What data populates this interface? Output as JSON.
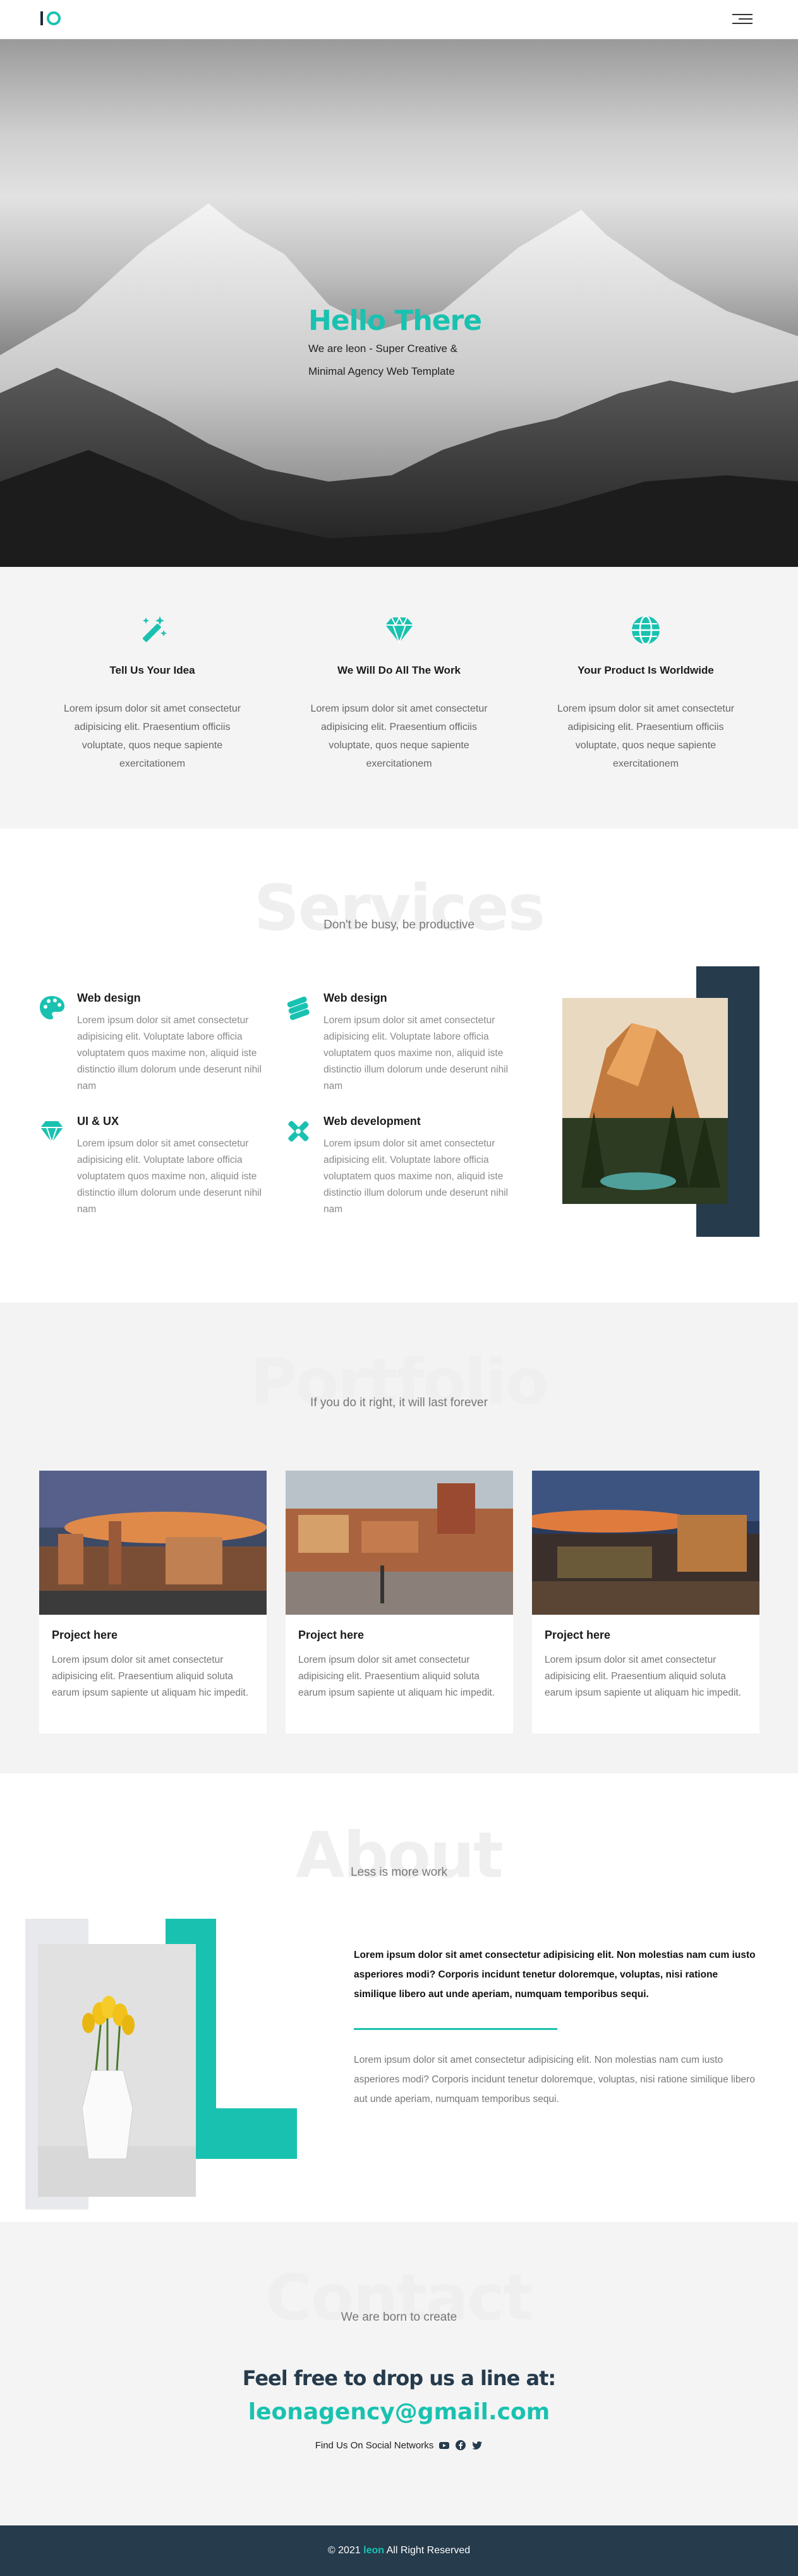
{
  "header": {
    "logo_alt": "leon",
    "menu_icon": "hamburger-menu-icon"
  },
  "hero": {
    "title": "Hello There",
    "subtitle_line1": "We are leon - Super Creative &",
    "subtitle_line2": "Minimal Agency Web Template"
  },
  "features": [
    {
      "icon": "magic-wand-icon",
      "title": "Tell Us Your Idea",
      "text": "Lorem ipsum dolor sit amet consectetur adipisicing elit. Praesentium officiis voluptate, quos neque sapiente exercitationem"
    },
    {
      "icon": "diamond-icon",
      "title": "We Will Do All The Work",
      "text": "Lorem ipsum dolor sit amet consectetur adipisicing elit. Praesentium officiis voluptate, quos neque sapiente exercitationem"
    },
    {
      "icon": "globe-icon",
      "title": "Your Product Is Worldwide",
      "text": "Lorem ipsum dolor sit amet consectetur adipisicing elit. Praesentium officiis voluptate, quos neque sapiente exercitationem"
    }
  ],
  "services": {
    "title": "Services",
    "subtitle": "Don't be busy, be productive",
    "items": [
      {
        "icon": "palette-icon",
        "title": "Web design",
        "text": "Lorem ipsum dolor sit amet consectetur adipisicing elit. Voluptate labore officia voluptatem quos maxime non, aliquid iste distinctio illum dolorum unde deserunt nihil nam"
      },
      {
        "icon": "stack-icon",
        "title": "Web design",
        "text": "Lorem ipsum dolor sit amet consectetur adipisicing elit. Voluptate labore officia voluptatem quos maxime non, aliquid iste distinctio illum dolorum unde deserunt nihil nam"
      },
      {
        "icon": "diamond-icon",
        "title": "UI & UX",
        "text": "Lorem ipsum dolor sit amet consectetur adipisicing elit. Voluptate labore officia voluptatem quos maxime non, aliquid iste distinctio illum dolorum unde deserunt nihil nam"
      },
      {
        "icon": "tools-icon",
        "title": "Web development",
        "text": "Lorem ipsum dolor sit amet consectetur adipisicing elit. Voluptate labore officia voluptatem quos maxime non, aliquid iste distinctio illum dolorum unde deserunt nihil nam"
      }
    ]
  },
  "portfolio": {
    "title": "Portfolio",
    "subtitle": "If you do it right, it will last forever",
    "cards": [
      {
        "title": "Project here",
        "text": "Lorem ipsum dolor sit amet consectetur adipisicing elit. Praesentium aliquid soluta earum ipsum sapiente ut aliquam hic impedit."
      },
      {
        "title": "Project here",
        "text": "Lorem ipsum dolor sit amet consectetur adipisicing elit. Praesentium aliquid soluta earum ipsum sapiente ut aliquam hic impedit."
      },
      {
        "title": "Project here",
        "text": "Lorem ipsum dolor sit amet consectetur adipisicing elit. Praesentium aliquid soluta earum ipsum sapiente ut aliquam hic impedit."
      }
    ]
  },
  "about": {
    "title": "About",
    "subtitle": "Less is more work",
    "bold_text": "Lorem ipsum dolor sit amet consectetur adipisicing elit. Non molestias nam cum iusto asperiores modi? Corporis incidunt tenetur doloremque, voluptas, nisi ratione similique libero aut unde aperiam, numquam temporibus sequi.",
    "text": "Lorem ipsum dolor sit amet consectetur adipisicing elit. Non molestias nam cum iusto asperiores modi? Corporis incidunt tenetur doloremque, voluptas, nisi ratione similique libero aut unde aperiam, numquam temporibus sequi."
  },
  "contact": {
    "title": "Contact",
    "subtitle": "We are born to create",
    "heading": "Feel free to drop us a line at:",
    "email": "leonagency@gmail.com",
    "social_label": "Find Us On Social Networks",
    "social_icons": [
      "youtube-icon",
      "facebook-icon",
      "twitter-icon"
    ]
  },
  "footer": {
    "prefix": "© 2021 ",
    "brand": "leon",
    "suffix": " All Right Reserved"
  },
  "colors": {
    "accent": "#19c2b0",
    "navy": "#263b4c"
  }
}
